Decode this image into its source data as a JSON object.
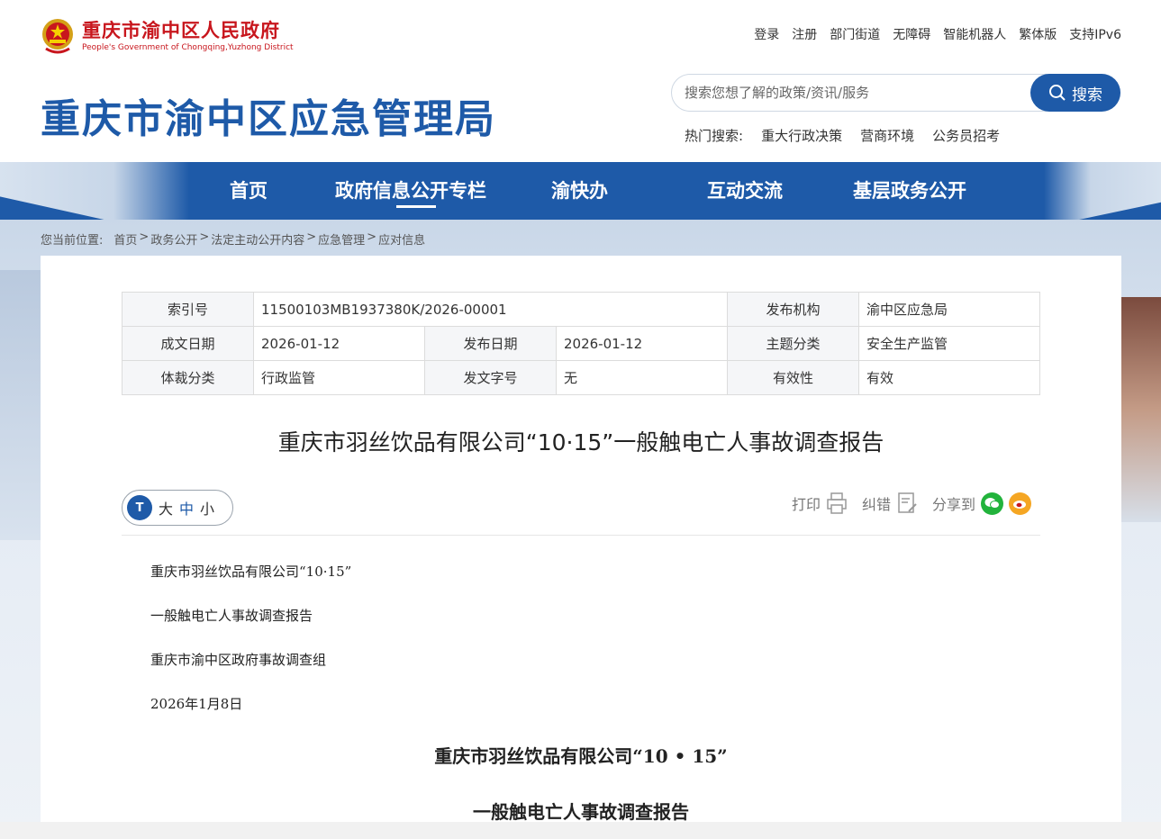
{
  "header": {
    "logo_cn": "重庆市渝中区人民政府",
    "logo_en": "People's Government of Chongqing,Yuzhong District",
    "site_title": "重庆市渝中区应急管理局",
    "top_links": [
      "登录",
      "注册",
      "部门街道",
      "无障碍",
      "智能机器人",
      "繁体版",
      "支持IPv6"
    ],
    "search": {
      "placeholder": "搜索您想了解的政策/资讯/服务",
      "button_label": "搜索"
    },
    "hot_search": {
      "label": "热门搜索:",
      "items": [
        "重大行政决策",
        "营商环境",
        "公务员招考"
      ]
    }
  },
  "nav": {
    "items": [
      "首页",
      "政府信息公开专栏",
      "渝快办",
      "互动交流",
      "基层政务公开"
    ],
    "active": "政府信息公开专栏"
  },
  "breadcrumb": {
    "label": "您当前位置:",
    "items": [
      "首页",
      "政务公开",
      "法定主动公开内容",
      "应急管理",
      "应对信息"
    ],
    "separator": ">"
  },
  "meta": {
    "index_no_label": "索引号",
    "index_no": "11500103MB1937380K/2026-00001",
    "publisher_label": "发布机构",
    "publisher": "渝中区应急局",
    "created_label": "成文日期",
    "created": "2026-01-12",
    "published_label": "发布日期",
    "published": "2026-01-12",
    "topic_label": "主题分类",
    "topic": "安全生产监管",
    "genre_label": "体裁分类",
    "genre": "行政监管",
    "doc_no_label": "发文字号",
    "doc_no": "无",
    "validity_label": "有效性",
    "validity": "有效"
  },
  "article": {
    "title": "重庆市羽丝饮品有限公司“10·15”一般触电亡人事故调查报告",
    "font_size": {
      "big": "大",
      "mid": "中",
      "small": "小"
    },
    "tools": {
      "print": "打印",
      "correct": "纠错",
      "share": "分享到"
    },
    "paragraphs": [
      "重庆市羽丝饮品有限公司“10·15”",
      "一般触电亡人事故调查报告",
      "重庆市渝中区政府事故调查组",
      "2026年1月8日"
    ],
    "heading_1": "重庆市羽丝饮品有限公司“10 • 15”",
    "heading_2": "一般触电亡人事故调查报告"
  },
  "colors": {
    "brand_blue": "#1e5aa8",
    "gov_red": "#c8161d",
    "wechat_green": "#22b33c",
    "weibo_orange": "#f5a623"
  }
}
